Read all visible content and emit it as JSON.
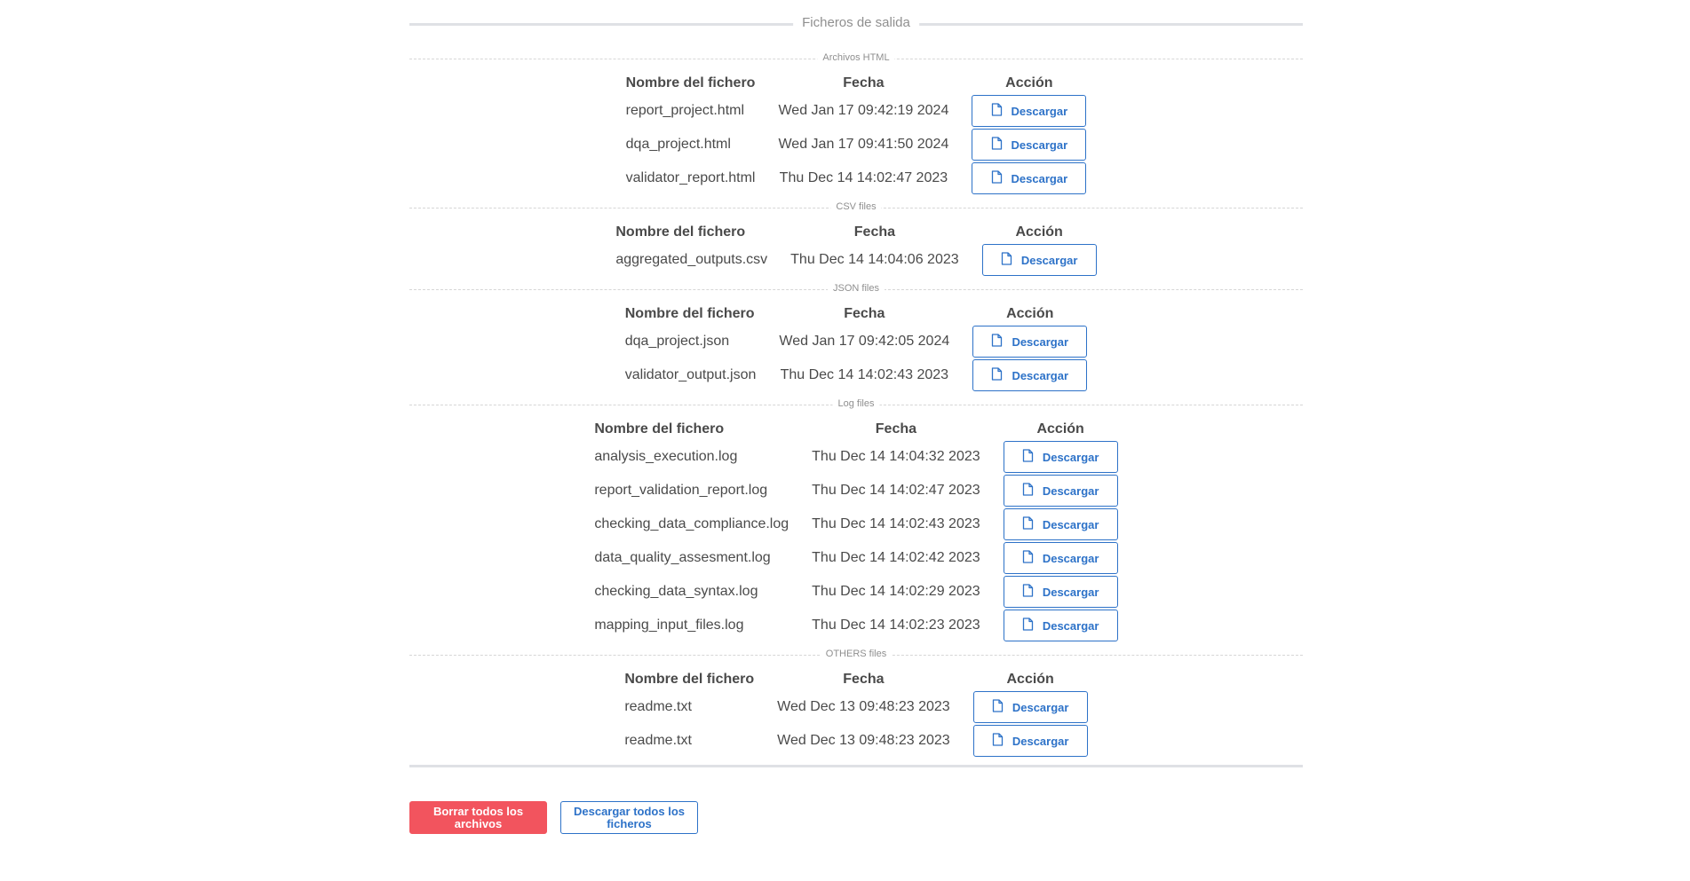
{
  "output_title": "Ficheros de salida",
  "columns": {
    "name": "Nombre del fichero",
    "date": "Fecha",
    "action": "Acción"
  },
  "download_label": "Descargar",
  "icons": {
    "download": "file-icon"
  },
  "colors": {
    "accent": "#2d72c8",
    "danger": "#f2545e"
  },
  "sections": [
    {
      "title": "Archivos HTML",
      "files": [
        {
          "name": "report_project.html",
          "date": "Wed Jan 17 09:42:19 2024"
        },
        {
          "name": "dqa_project.html",
          "date": "Wed Jan 17 09:41:50 2024"
        },
        {
          "name": "validator_report.html",
          "date": "Thu Dec 14 14:02:47 2023"
        }
      ]
    },
    {
      "title": "CSV files",
      "files": [
        {
          "name": "aggregated_outputs.csv",
          "date": "Thu Dec 14 14:04:06 2023"
        }
      ]
    },
    {
      "title": "JSON files",
      "files": [
        {
          "name": "dqa_project.json",
          "date": "Wed Jan 17 09:42:05 2024"
        },
        {
          "name": "validator_output.json",
          "date": "Thu Dec 14 14:02:43 2023"
        }
      ]
    },
    {
      "title": "Log files",
      "files": [
        {
          "name": "analysis_execution.log",
          "date": "Thu Dec 14 14:04:32 2023"
        },
        {
          "name": "report_validation_report.log",
          "date": "Thu Dec 14 14:02:47 2023"
        },
        {
          "name": "checking_data_compliance.log",
          "date": "Thu Dec 14 14:02:43 2023"
        },
        {
          "name": "data_quality_assesment.log",
          "date": "Thu Dec 14 14:02:42 2023"
        },
        {
          "name": "checking_data_syntax.log",
          "date": "Thu Dec 14 14:02:29 2023"
        },
        {
          "name": "mapping_input_files.log",
          "date": "Thu Dec 14 14:02:23 2023"
        }
      ]
    },
    {
      "title": "OTHERS files",
      "files": [
        {
          "name": "readme.txt",
          "date": "Wed Dec 13 09:48:23 2023"
        },
        {
          "name": "readme.txt",
          "date": "Wed Dec 13 09:48:23 2023"
        }
      ]
    }
  ],
  "footer": {
    "delete_all_label": "Borrar todos los archivos",
    "download_all_label": "Descargar todos los ficheros"
  }
}
